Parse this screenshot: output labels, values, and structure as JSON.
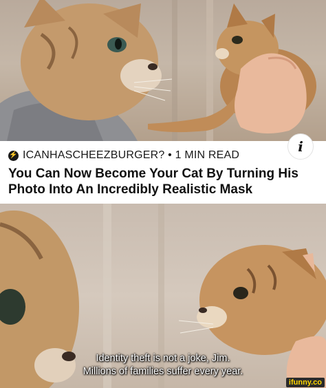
{
  "article": {
    "source_icon": "lightning-bolt-icon",
    "source_text": "ICANHASCHEEZBURGER? • 1 MIN READ",
    "headline": "You Can Now Become Your Cat By Turning His Photo Into An Incredibly Realistic Mask",
    "info_icon": "info-icon",
    "info_glyph": "i"
  },
  "caption": {
    "line1": "Identity theft is not a joke, Jim.",
    "line2": "Millions of families suffer every year."
  },
  "watermark": {
    "text": "ifunny.co"
  },
  "colors": {
    "background": "#ffffff",
    "headline_text": "#111111",
    "subtitle_text": "#ffffff",
    "watermark_bg": "#2b2b2b",
    "watermark_text": "#ffd400"
  }
}
